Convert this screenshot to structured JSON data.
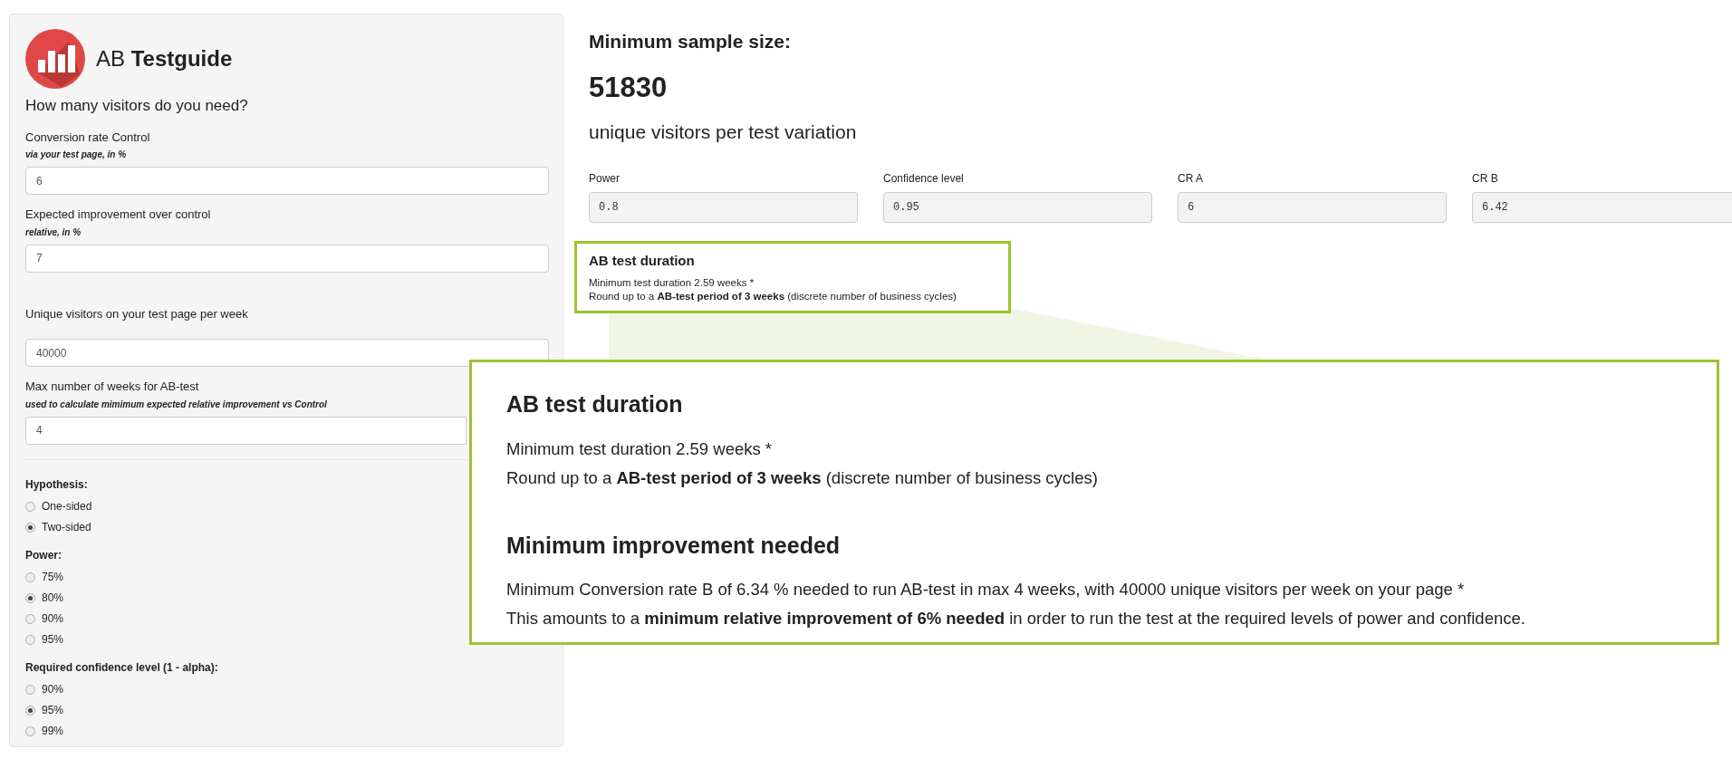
{
  "sidebar": {
    "logo": {
      "light": "AB",
      "bold": "Testguide"
    },
    "heading": "How many visitors do you need?",
    "fields": [
      {
        "label": "Conversion rate Control",
        "hint": "via your test page, in %",
        "value": "6"
      },
      {
        "label": "Expected improvement over control",
        "hint": "relative, in %",
        "value": "7"
      },
      {
        "label": "Unique visitors on your test page per week",
        "value": "40000"
      },
      {
        "label": "Max number of weeks for AB-test",
        "hint": "used to calculate mimimum expected relative improvement vs Control",
        "value": "4"
      }
    ],
    "radio_groups": [
      {
        "title": "Hypothesis:",
        "options": [
          {
            "label": "One-sided",
            "selected": false
          },
          {
            "label": "Two-sided",
            "selected": true
          }
        ]
      },
      {
        "title": "Power:",
        "options": [
          {
            "label": "75%",
            "selected": false
          },
          {
            "label": "80%",
            "selected": true
          },
          {
            "label": "90%",
            "selected": false
          },
          {
            "label": "95%",
            "selected": false
          }
        ]
      },
      {
        "title": "Required confidence level (1 - alpha):",
        "options": [
          {
            "label": "90%",
            "selected": false
          },
          {
            "label": "95%",
            "selected": true
          },
          {
            "label": "99%",
            "selected": false
          }
        ]
      }
    ]
  },
  "results": {
    "title": "Minimum sample size:",
    "value": "51830",
    "subtitle": "unique visitors per test variation",
    "outputs": [
      {
        "label": "Power",
        "value": "0.8"
      },
      {
        "label": "Confidence level",
        "value": "0.95"
      },
      {
        "label": "CR A",
        "value": "6"
      },
      {
        "label": "CR B",
        "value": "6.42"
      }
    ],
    "duration": {
      "title": "AB test duration",
      "lines": [
        "Minimum test duration 2.59 weeks *",
        "Round up to a **AB-test period of 3 weeks** (discrete number of business cycles)"
      ]
    }
  },
  "callout": {
    "sections": [
      {
        "title": "AB test duration",
        "lines": [
          "Minimum test duration 2.59 weeks *",
          "Round up to a **AB-test period of 3 weeks** (discrete number of business cycles)"
        ]
      },
      {
        "title": "Minimum improvement needed",
        "lines": [
          "Minimum Conversion rate B of 6.34 % needed to run AB-test in max 4 weeks, with 40000 unique visitors per week on your page *",
          "This amounts to a **minimum relative improvement of 6% needed** in order to run the test at the required levels of power and confidence."
        ]
      }
    ]
  }
}
